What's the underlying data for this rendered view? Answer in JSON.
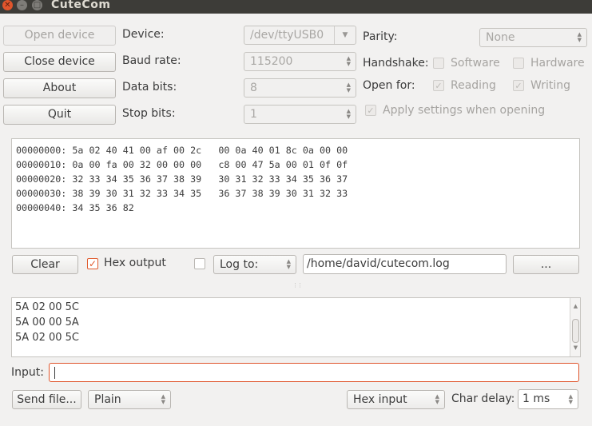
{
  "window": {
    "title": "CuteCom"
  },
  "buttons": {
    "open_device": "Open device",
    "close_device": "Close device",
    "about": "About",
    "quit": "Quit",
    "clear": "Clear",
    "browse": "...",
    "send_file": "Send file..."
  },
  "settings": {
    "device_label": "Device:",
    "device_value": "/dev/ttyUSB0",
    "baud_label": "Baud rate:",
    "baud_value": "115200",
    "databits_label": "Data bits:",
    "databits_value": "8",
    "stopbits_label": "Stop bits:",
    "stopbits_value": "1",
    "parity_label": "Parity:",
    "parity_value": "None",
    "handshake_label": "Handshake:",
    "software_label": "Software",
    "hardware_label": "Hardware",
    "openfor_label": "Open for:",
    "reading_label": "Reading",
    "writing_label": "Writing",
    "apply_label": "Apply settings when opening"
  },
  "hex_output_lines": [
    "00000000: 5a 02 40 41 00 af 00 2c   00 0a 40 01 8c 0a 00 00",
    "00000010: 0a 00 fa 00 32 00 00 00   c8 00 47 5a 00 01 0f 0f",
    "00000020: 32 33 34 35 36 37 38 39   30 31 32 33 34 35 36 37",
    "00000030: 38 39 30 31 32 33 34 35   36 37 38 39 30 31 32 33",
    "00000040: 34 35 36 82"
  ],
  "output_controls": {
    "hex_output_label": "Hex output",
    "log_to_label": "Log to:",
    "log_path": "/home/david/cutecom.log"
  },
  "sent_lines": [
    "5A 02 00 5C",
    "5A 00 00 5A",
    "5A 02 00 5C"
  ],
  "input": {
    "label": "Input:",
    "value": ""
  },
  "bottom": {
    "mode_value": "Plain",
    "input_mode_value": "Hex input",
    "char_delay_label": "Char delay:",
    "char_delay_value": "1 ms"
  }
}
